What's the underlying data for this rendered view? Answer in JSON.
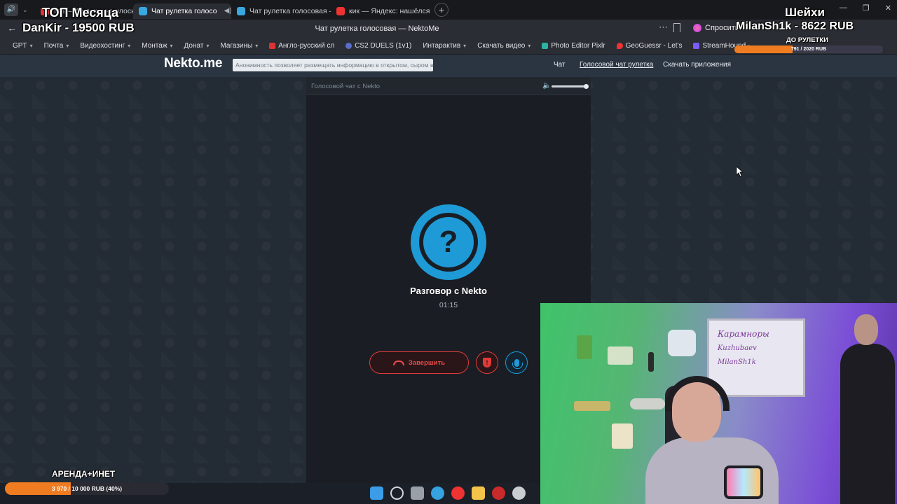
{
  "browser": {
    "tabs": [
      {
        "label": "топ — Яндекс: нашлось",
        "fav": "#e33"
      },
      {
        "label": "Чат рулетка голосо",
        "fav": "#3aa8e0",
        "active": true
      },
      {
        "label": "Чат рулетка голосовая —",
        "fav": "#3aa8e0"
      },
      {
        "label": "кик — Яндекс: нашёлся 1",
        "fav": "#e33"
      }
    ],
    "window_title": "Чат рулетка голосовая — NektoMe",
    "ask_label": "Спросить",
    "bookmarks": [
      {
        "label": "GPT",
        "chev": true
      },
      {
        "label": "Почта",
        "chev": true
      },
      {
        "label": "Видеохостинг",
        "chev": true
      },
      {
        "label": "Монтаж",
        "chev": true
      },
      {
        "label": "Донат",
        "chev": true
      },
      {
        "label": "Магазины",
        "chev": true
      },
      {
        "label": "Англо-русский сл",
        "icon": "#d33"
      },
      {
        "label": "CS2 DUELS (1v1)",
        "icon": "#5b6cc9"
      },
      {
        "label": "Интарактив",
        "chev": true
      },
      {
        "label": "Скачать видео",
        "chev": true
      },
      {
        "label": "Photo Editor Pixlr",
        "icon": "#2bb3a3"
      },
      {
        "label": "GeoGuessr - Let's",
        "icon": "#e33"
      },
      {
        "label": "StreamHound -",
        "icon": "#7a5cff"
      }
    ]
  },
  "site": {
    "logo": "Nekto.me",
    "notice": "Анонимность позволяет размещать информацию в открытом, сыром виде!",
    "nav": {
      "chat": "Чат",
      "voice": "Голосовой чат рулетка",
      "apps": "Скачать приложения"
    }
  },
  "call": {
    "header_title": "Голосовой чат с Nekto",
    "volume": 1.0,
    "avatar_symbol": "?",
    "talk_title": "Разговор с Nekto",
    "timer": "01:15",
    "end_label": "Завершить",
    "report_symbol": "!"
  },
  "overlay": {
    "top_month": "ТОП Месяца",
    "top_donor": "DanKir - 19500 RUB",
    "sheikhs": "Шейхи",
    "sheikh_donor": "MilanSh1k - 8622 RUB",
    "roulette_label": "ДО РУЛЕТКИ",
    "roulette_progress_text": "791 / 2020 RUB",
    "roulette_progress": 0.39,
    "rent_label": "АРЕНДА+ИНЕТ",
    "rent_progress_text": "3 970 / 10 000 RUB (40%)",
    "rent_progress": 0.4,
    "accent": "#f07c22"
  },
  "webcam": {
    "whiteboard_lines": [
      "Карамноры",
      "Kuzhubaev",
      "MilanSh1k"
    ]
  },
  "taskbar": {
    "icons": [
      {
        "name": "windows-start-icon",
        "color": "#3b9de8"
      },
      {
        "name": "search-icon",
        "color": "#d0d4da"
      },
      {
        "name": "task-view-icon",
        "color": "#9aa0a8"
      },
      {
        "name": "telegram-icon",
        "color": "#36a2e0"
      },
      {
        "name": "yandex-browser-icon",
        "color": "#e33"
      },
      {
        "name": "file-explorer-icon",
        "color": "#f3c34a"
      },
      {
        "name": "obs-icon",
        "color": "#c92a2a"
      },
      {
        "name": "steam-icon",
        "color": "#c9ccd1"
      }
    ]
  }
}
